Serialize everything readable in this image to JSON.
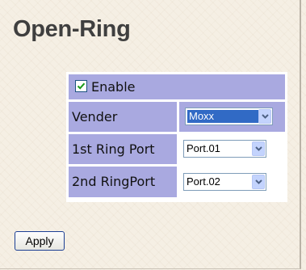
{
  "page": {
    "title": "Open-Ring"
  },
  "form": {
    "enable": {
      "label": "Enable",
      "checked": true
    },
    "vender": {
      "label": "Vender",
      "value": "Moxx"
    },
    "ring_port_1": {
      "label": "1st Ring Port",
      "value": "Port.01"
    },
    "ring_port_2": {
      "label": "2nd RingPort",
      "value": "Port.02"
    }
  },
  "actions": {
    "apply_label": "Apply"
  },
  "icons": {
    "checkbox": "checkmark-icon",
    "dropdown": "chevron-down-icon"
  },
  "colors": {
    "background": "#f5efe4",
    "table_header": "#a9a9e0",
    "select_highlight": "#316ac5",
    "dropdown_button": "#c3d3fd",
    "checkbox_border": "#1c5180"
  }
}
